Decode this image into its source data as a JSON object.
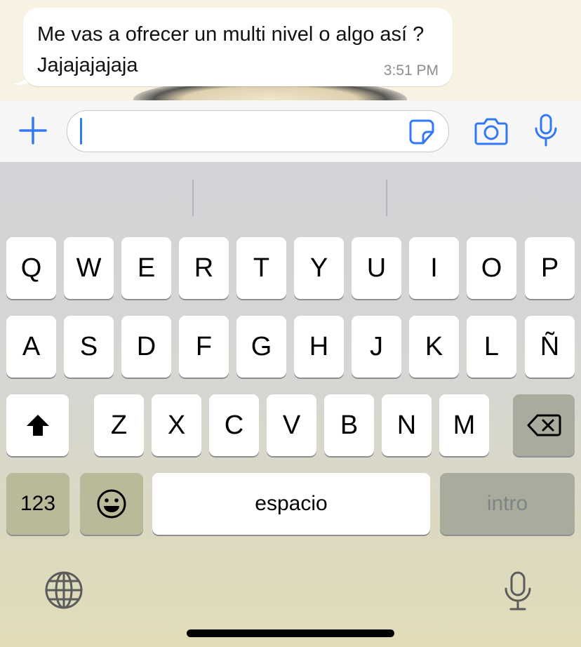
{
  "message": {
    "text": "Me vas a ofrecer un multi nivel o algo así ? Jajajajajaja",
    "time": "3:51 PM"
  },
  "input_bar": {
    "placeholder": "",
    "icons": [
      "plus-icon",
      "sticker-icon",
      "camera-icon",
      "microphone-icon"
    ],
    "accent_color": "#3478f6"
  },
  "keyboard": {
    "row1": [
      "Q",
      "W",
      "E",
      "R",
      "T",
      "Y",
      "U",
      "I",
      "O",
      "P"
    ],
    "row2": [
      "A",
      "S",
      "D",
      "F",
      "G",
      "H",
      "J",
      "K",
      "L",
      "Ñ"
    ],
    "row3": [
      "Z",
      "X",
      "C",
      "V",
      "B",
      "N",
      "M"
    ],
    "numbers_label": "123",
    "space_label": "espacio",
    "return_label": "intro",
    "icons": [
      "shift-icon",
      "backspace-icon",
      "emoji-icon",
      "globe-icon",
      "dictation-icon"
    ]
  }
}
